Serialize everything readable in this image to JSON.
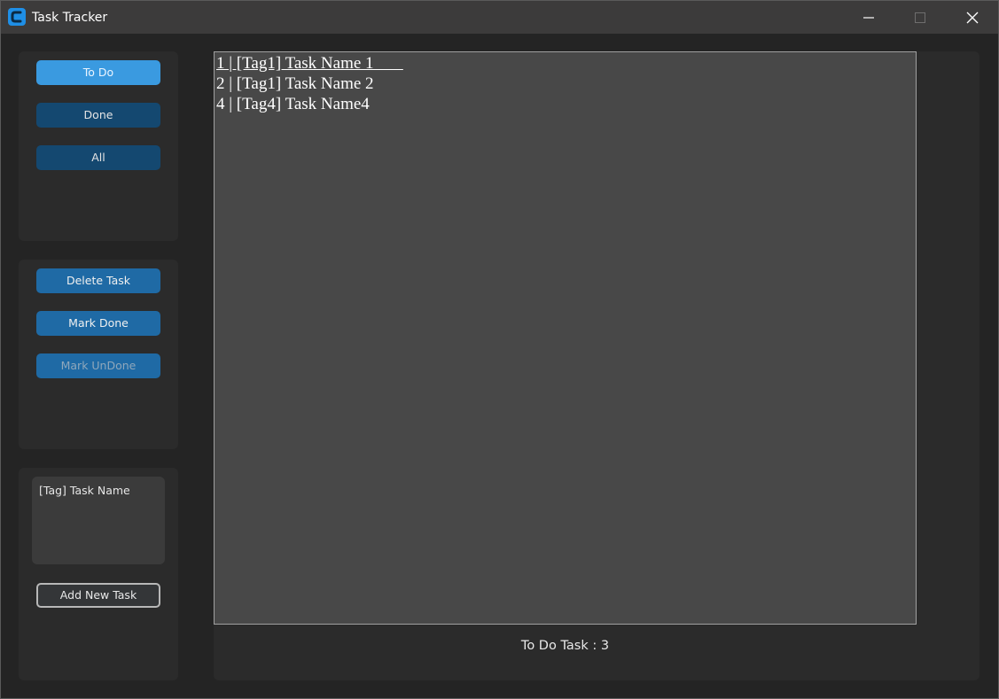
{
  "window": {
    "title": "Task Tracker"
  },
  "filters": {
    "todo_label": "To Do",
    "done_label": "Done",
    "all_label": "All"
  },
  "actions": {
    "delete_label": "Delete Task",
    "mark_done_label": "Mark Done",
    "mark_undone_label": "Mark UnDone"
  },
  "new_task": {
    "input_value": "[Tag] Task Name",
    "add_label": "Add New Task"
  },
  "tasks": [
    "1 | [Tag1] Task Name 1       ",
    "2 | [Tag1] Task Name 2",
    "4 | [Tag4] Task Name4"
  ],
  "status": {
    "text": "To Do Task : 3"
  },
  "colors": {
    "accent": "#3a9ae0",
    "button": "#1f6aa5",
    "button_dark": "#144870"
  }
}
